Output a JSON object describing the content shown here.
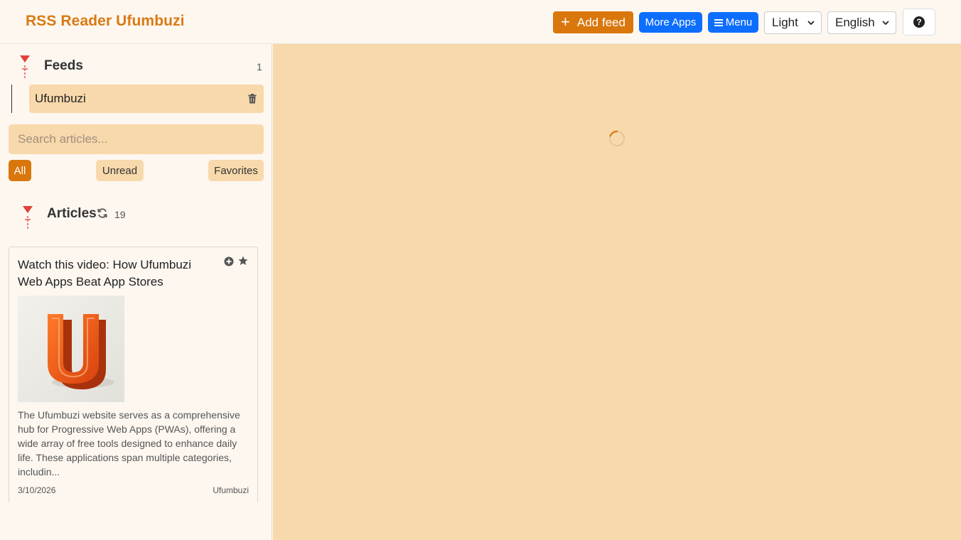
{
  "header": {
    "title": "RSS Reader Ufumbuzi",
    "add_feed_label": "Add feed",
    "more_apps_label": "More Apps",
    "menu_label": "Menu",
    "theme_selected": "Light",
    "language_selected": "English",
    "help_glyph": "?"
  },
  "sidebar": {
    "feeds_title": "Feeds",
    "feeds_count": "1",
    "feeds": [
      {
        "name": "Ufumbuzi"
      }
    ],
    "search_placeholder": "Search articles...",
    "filters": {
      "all": "All",
      "unread": "Unread",
      "favorites": "Favorites"
    },
    "articles_title": "Articles",
    "articles_count": "19",
    "articles": [
      {
        "title": "Watch this video: How Ufumbuzi Web Apps Beat App Stores",
        "description": "The Ufumbuzi website serves as a comprehensive hub for Progressive Web Apps (PWAs), offering a wide array of free tools designed to enhance daily life. These applications span multiple categories, includin...",
        "date": "3/10/2026",
        "source": "Ufumbuzi",
        "thumbnail_letter": "U"
      }
    ]
  },
  "main": {
    "state": "loading"
  },
  "colors": {
    "accent": "#d9770d",
    "title": "#d97a12",
    "blue": "#0d6efd",
    "panel": "#f8d9ab",
    "background": "#fdf7f0",
    "toggle_red": "#e0413a"
  },
  "icons": [
    "plus-icon",
    "hamburger-icon",
    "chevron-down-icon",
    "question-circle-icon",
    "collapse-toggle-icon",
    "trash-icon",
    "refresh-icon",
    "plus-circle-icon",
    "star-icon",
    "loading-spinner"
  ]
}
